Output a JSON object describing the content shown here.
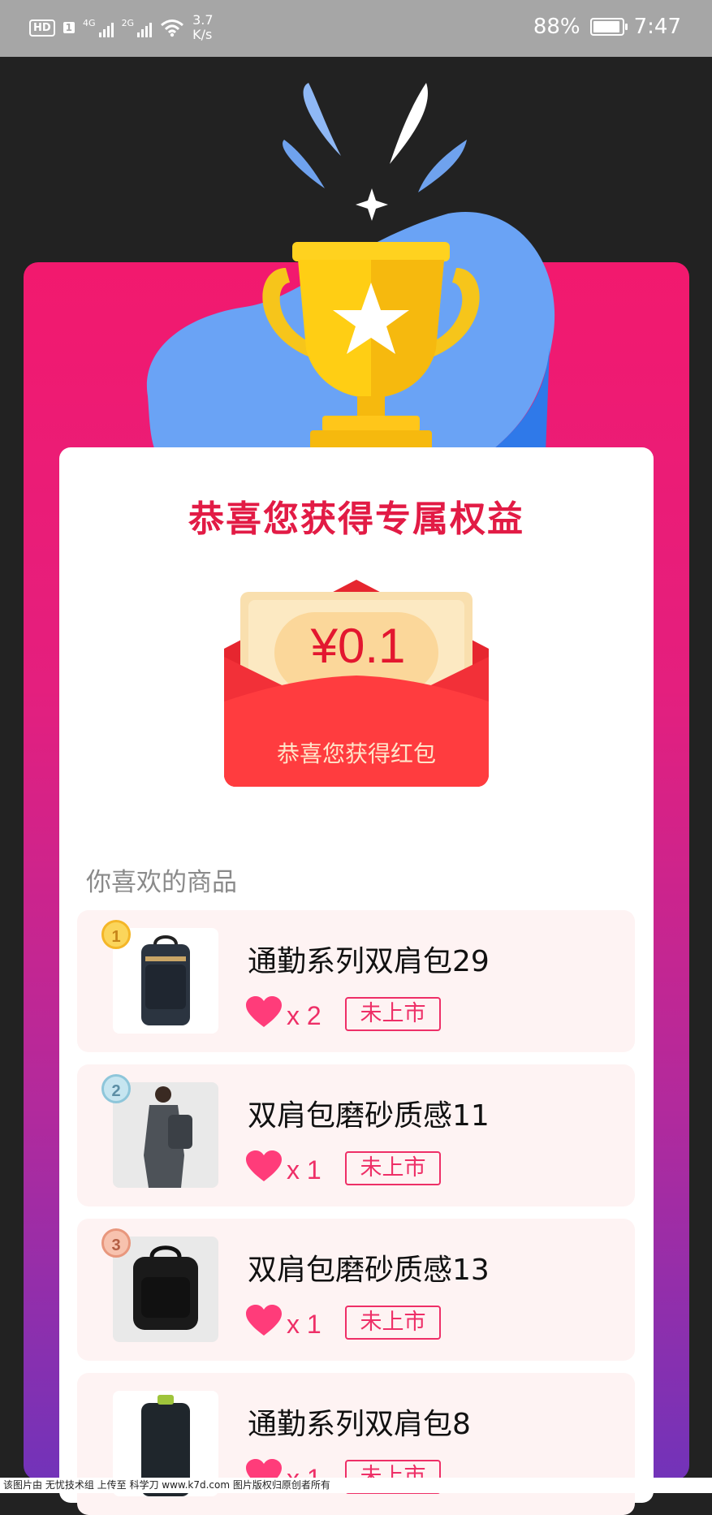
{
  "status_bar": {
    "hd": "HD",
    "sim": "1",
    "net1": "4G",
    "net2": "2G",
    "speed_value": "3.7",
    "speed_unit": "K/s",
    "battery": "88%",
    "time": "7:47"
  },
  "card": {
    "title": "恭喜您获得专属权益",
    "red_packet": {
      "amount": "¥0.1",
      "caption": "恭喜您获得红包"
    },
    "section_title": "你喜欢的商品"
  },
  "products": [
    {
      "rank": "1",
      "name": "通勤系列双肩包29",
      "likes": "x 2",
      "status": "未上市"
    },
    {
      "rank": "2",
      "name": "双肩包磨砂质感11",
      "likes": "x 1",
      "status": "未上市"
    },
    {
      "rank": "3",
      "name": "双肩包磨砂质感13",
      "likes": "x 1",
      "status": "未上市"
    },
    {
      "name": "通勤系列双肩包8",
      "likes": "x 1",
      "status": "未上市"
    }
  ],
  "watermark": "该图片由 无忧技术组 上传至 科学刀 www.k7d.com 图片版权归原创者所有",
  "colors": {
    "title_red": "#e21b45",
    "accent_pink": "#ee2f67",
    "panel_top": "#f2196e",
    "panel_bottom": "#7233b9"
  }
}
